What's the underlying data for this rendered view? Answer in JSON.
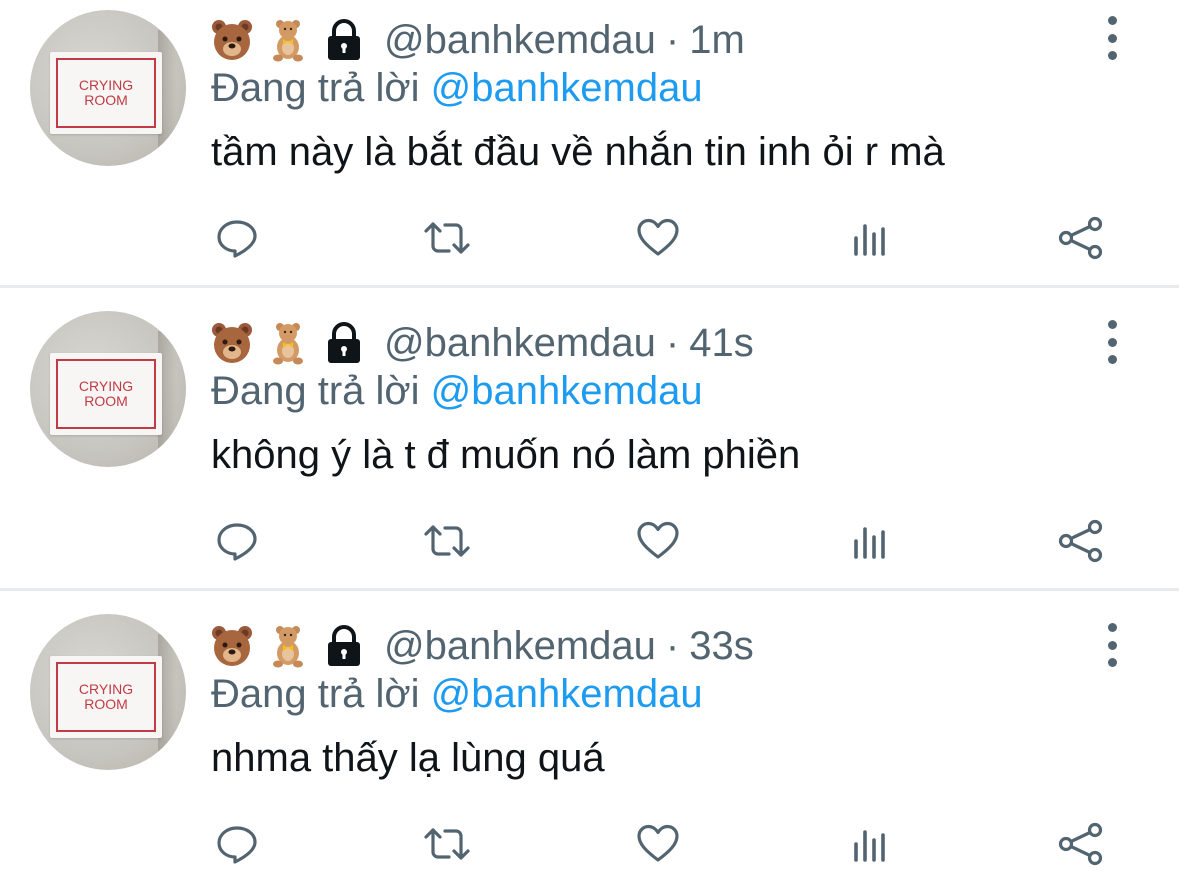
{
  "tweets": [
    {
      "avatar_text_line1": "CRYING",
      "avatar_text_line2": "ROOM",
      "handle": "@banhkemdau",
      "separator": "·",
      "time": "1m",
      "reply_prefix": "Đang trả lời",
      "reply_handle": "@banhkemdau",
      "text": "tầm này là bắt đầu về nhắn tin inh ỏi r mà"
    },
    {
      "avatar_text_line1": "CRYING",
      "avatar_text_line2": "ROOM",
      "handle": "@banhkemdau",
      "separator": "·",
      "time": "41s",
      "reply_prefix": "Đang trả lời",
      "reply_handle": "@banhkemdau",
      "text": "không ý là t đ muốn nó làm phiền"
    },
    {
      "avatar_text_line1": "CRYING",
      "avatar_text_line2": "ROOM",
      "handle": "@banhkemdau",
      "separator": "·",
      "time": "33s",
      "reply_prefix": "Đang trả lời",
      "reply_handle": "@banhkemdau",
      "text": "nhma thấy lạ lùng quá"
    }
  ],
  "icons": {
    "name_emojis": [
      "bear-face-icon",
      "teddy-bear-icon",
      "lock-icon"
    ],
    "actions": [
      "reply-icon",
      "retweet-icon",
      "like-icon",
      "views-icon",
      "share-icon"
    ],
    "menu": "more-options-icon"
  },
  "colors": {
    "secondary_text": "#536471",
    "link": "#1d9bf0",
    "primary_text": "#0f1419",
    "divider": "#e7ebee",
    "sign_red": "#c13b45"
  }
}
